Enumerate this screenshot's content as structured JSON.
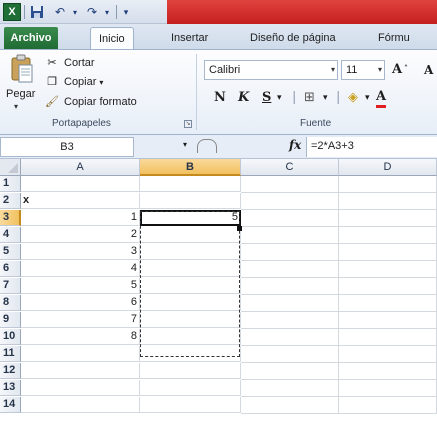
{
  "quick_access": {
    "excel_icon": "excel-icon",
    "save_icon": "save-icon",
    "undo_icon": "undo-icon",
    "redo_icon": "redo-icon",
    "customize_icon": "customize-icon"
  },
  "tabs": [
    {
      "label": "Archivo"
    },
    {
      "label": "Inicio"
    },
    {
      "label": "Insertar"
    },
    {
      "label": "Diseño de página"
    },
    {
      "label": "Fórmu"
    }
  ],
  "ribbon": {
    "clipboard": {
      "paste_label": "Pegar",
      "cut_label": "Cortar",
      "copy_label": "Copiar",
      "format_painter_label": "Copiar formato",
      "group_label": "Portapapeles"
    },
    "font": {
      "font_name": "Calibri",
      "font_size": "11",
      "bold": "N",
      "italic": "K",
      "underline": "S",
      "grow_font": "A",
      "font_color": "A",
      "group_label": "Fuente"
    }
  },
  "formula_bar": {
    "name_box": "B3",
    "fx_label": "fx",
    "formula": "=2*A3+3"
  },
  "grid": {
    "columns": [
      "A",
      "B",
      "C",
      "D"
    ],
    "rows": [
      "1",
      "2",
      "3",
      "4",
      "5",
      "6",
      "7",
      "8",
      "9",
      "10",
      "11",
      "12",
      "13",
      "14"
    ],
    "cells": {
      "A2": "x",
      "A3": "1",
      "A4": "2",
      "A5": "3",
      "A6": "4",
      "A7": "5",
      "A8": "6",
      "A9": "7",
      "A10": "8",
      "B3": "5"
    },
    "active_cell": "B3",
    "colors": {
      "selected_header": "#f1c15f",
      "file_tab": "#1f6b34",
      "title_accent": "#c41f1f"
    }
  }
}
